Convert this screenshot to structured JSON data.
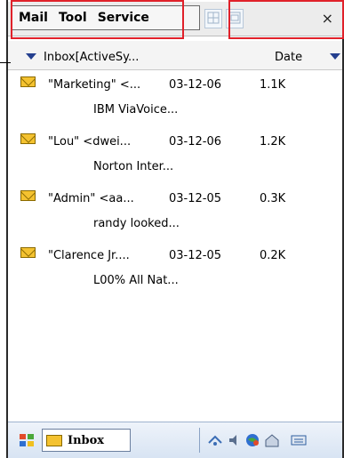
{
  "menu": {
    "items": [
      "Mail",
      "Tool",
      "Service"
    ],
    "close_label": "×"
  },
  "columns": {
    "folder_label": "Inbox[ActiveSy...",
    "sort_label": "Date"
  },
  "messages": [
    {
      "from": "\"Marketing\" <...",
      "date": "03-12-06",
      "size": "1.1K",
      "preview": "IBM ViaVoice..."
    },
    {
      "from": "\"Lou\" <dwei...",
      "date": "03-12-06",
      "size": "1.2K",
      "preview": "Norton Inter..."
    },
    {
      "from": "\"Admin\" <aa...",
      "date": "03-12-05",
      "size": "0.3K",
      "preview": "randy looked..."
    },
    {
      "from": "\"Clarence Jr....",
      "date": "03-12-05",
      "size": "0.2K",
      "preview": "L00% All Nat..."
    }
  ],
  "taskbar": {
    "inbox_label": "Inbox"
  },
  "colors": {
    "highlight_border": "#e0212a",
    "envelope": "#f4c230",
    "dropdown_arrow": "#243f8f"
  }
}
